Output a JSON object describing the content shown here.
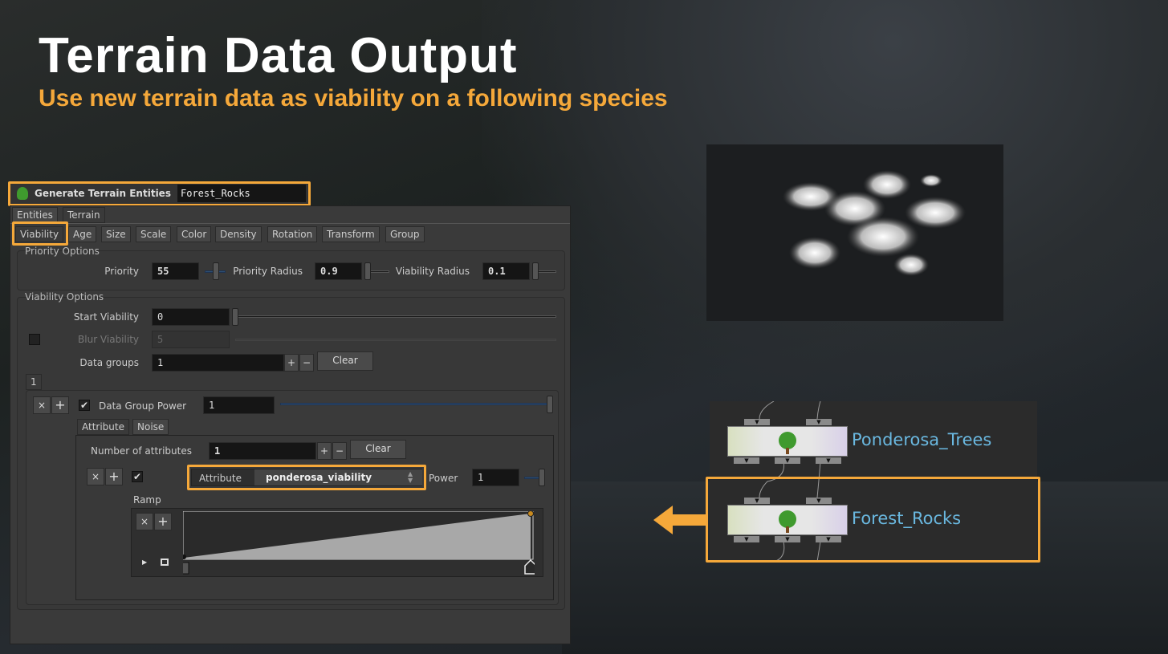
{
  "slide": {
    "title": "Terrain Data Output",
    "subtitle": "Use new terrain data as viability on a following species",
    "accent": "#f5a83a"
  },
  "node_header": {
    "type": "Generate Terrain Entities",
    "name": "Forest_Rocks",
    "icon": "tree-icon"
  },
  "top_tabs": [
    "Entities",
    "Terrain"
  ],
  "sub_tabs": [
    "Viability",
    "Age",
    "Size",
    "Scale",
    "Color",
    "Density",
    "Rotation",
    "Transform",
    "Group"
  ],
  "priority": {
    "group_label": "Priority Options",
    "priority_label": "Priority",
    "priority": "55",
    "priority_radius_label": "Priority Radius",
    "priority_radius": "0.9",
    "viability_radius_label": "Viability Radius",
    "viability_radius": "0.1"
  },
  "viability": {
    "group_label": "Viability Options",
    "start_label": "Start Viability",
    "start": "0",
    "blur_label": "Blur Viability",
    "blur": "5",
    "data_groups_label": "Data groups",
    "data_groups": "1",
    "plus": "+",
    "minus": "−",
    "clear": "Clear"
  },
  "data_group": {
    "tab": "1",
    "remove": "×",
    "add": "+",
    "check": "✔",
    "power_label": "Data Group Power",
    "power": "1",
    "inner_tabs": [
      "Attribute",
      "Noise"
    ],
    "num_attr_label": "Number of attributes",
    "num_attr": "1",
    "clear": "Clear",
    "attribute_label": "Attribute",
    "attribute": "ponderosa_viability",
    "attr_power_label": "Power",
    "attr_power": "1",
    "ramp_label": "Ramp",
    "ramp_points": [
      {
        "pos": 0,
        "value": 0
      },
      {
        "pos": 1,
        "value": 1
      }
    ]
  },
  "network": {
    "nodes": [
      {
        "name": "Ponderosa_Trees"
      },
      {
        "name": "Forest_Rocks",
        "selected": true
      }
    ],
    "node_name_color": "#6ab8e0"
  }
}
